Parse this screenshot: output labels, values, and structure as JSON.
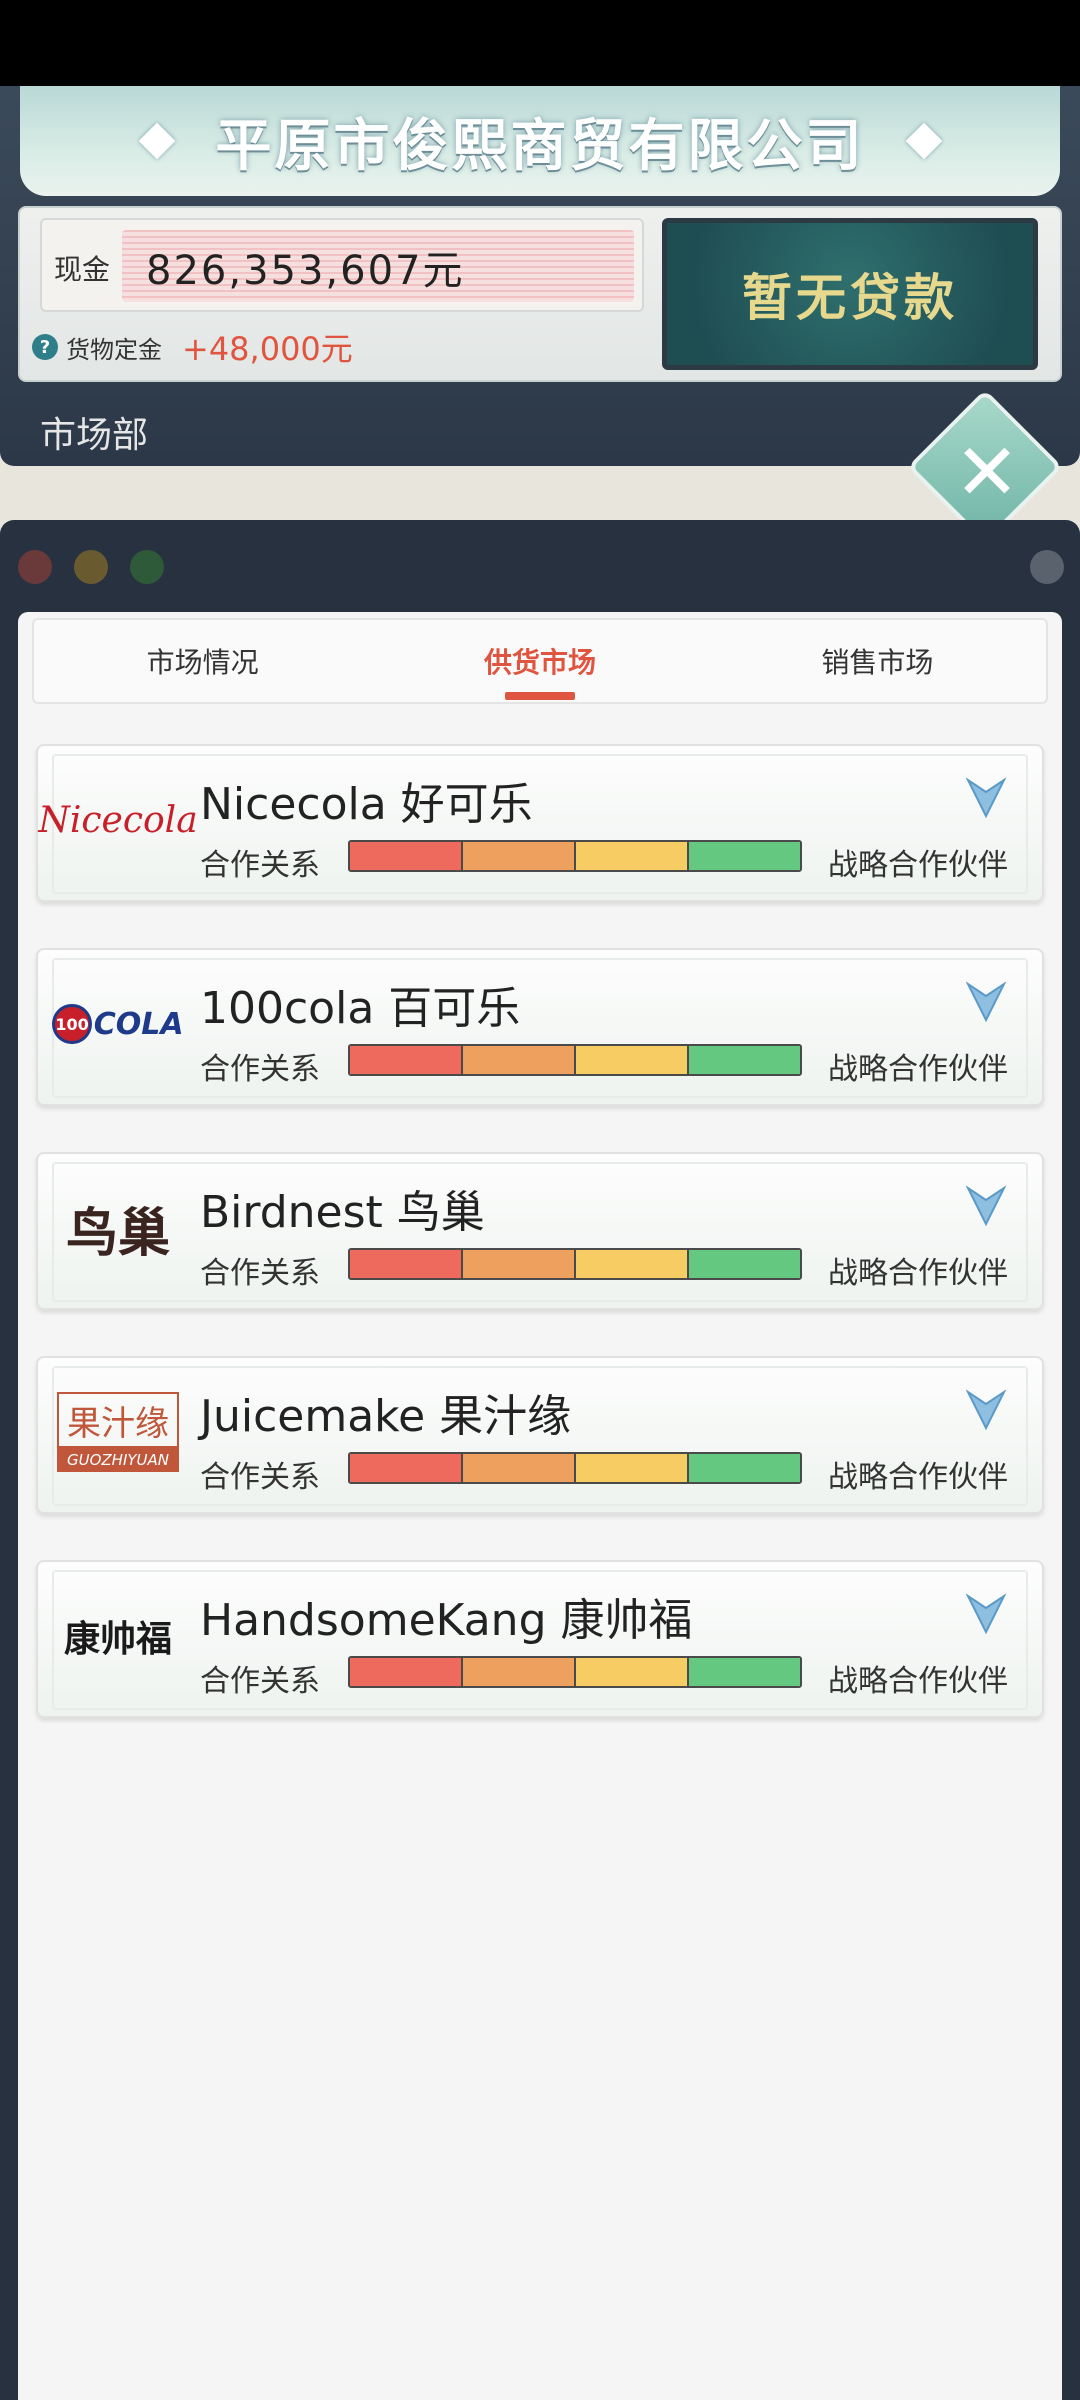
{
  "header": {
    "company_name": "平原市俊熙商贸有限公司",
    "cash_label": "现金",
    "cash_value": "826,353,607元",
    "deposit_label": "货物定金",
    "deposit_value": "+48,000元",
    "loan_button": "暂无贷款",
    "department": "市场部"
  },
  "tabs": [
    {
      "label": "市场情况",
      "active": false
    },
    {
      "label": "供货市场",
      "active": true
    },
    {
      "label": "销售市场",
      "active": false
    }
  ],
  "suppliers": [
    {
      "name": "Nicecola 好可乐",
      "logo_text": "Nicecola",
      "relation_label": "合作关系",
      "relation_status": "战略合作伙伴",
      "relation_level": 4
    },
    {
      "name": "100cola 百可乐",
      "logo_text": "COLA",
      "logo_badge": "100",
      "relation_label": "合作关系",
      "relation_status": "战略合作伙伴",
      "relation_level": 4
    },
    {
      "name": "Birdnest 鸟巢",
      "logo_text": "鸟巢",
      "relation_label": "合作关系",
      "relation_status": "战略合作伙伴",
      "relation_level": 4
    },
    {
      "name": "Juicemake 果汁缘",
      "logo_text": "果汁缘",
      "logo_sub": "GUOZHIYUAN",
      "relation_label": "合作关系",
      "relation_status": "战略合作伙伴",
      "relation_level": 4
    },
    {
      "name": "HandsomeKang 康帅福",
      "logo_text": "康帅福",
      "relation_label": "合作关系",
      "relation_status": "战略合作伙伴",
      "relation_level": 4
    }
  ],
  "colors": {
    "accent": "#e0553f",
    "loan_text": "#e6d98e",
    "bar_red": "#ee6a5d",
    "bar_orange": "#eea15e",
    "bar_yellow": "#f6cc63",
    "bar_green": "#65c880"
  },
  "icons": {
    "close": "close-icon",
    "help": "question-icon",
    "expand": "chevron-down-icon"
  }
}
